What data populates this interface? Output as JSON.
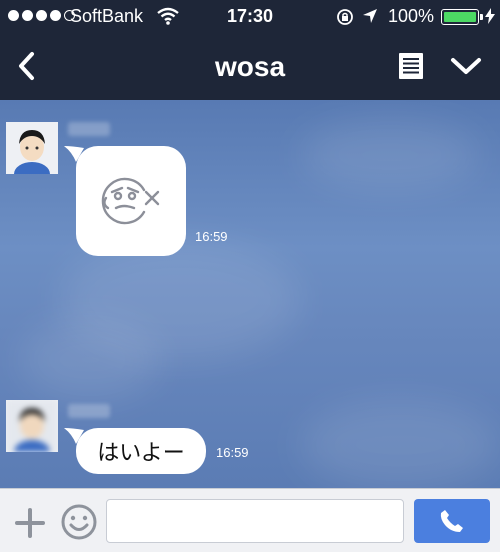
{
  "status_bar": {
    "carrier": "SoftBank",
    "time": "17:30",
    "battery_percent": "100%",
    "signal_dots_filled": 4,
    "signal_dots_total": 5,
    "battery_level": 1.0,
    "icons": [
      "wifi-icon",
      "rotation-lock-icon",
      "location-arrow-icon",
      "battery-icon",
      "charging-bolt-icon"
    ]
  },
  "nav_bar": {
    "title": "wosa",
    "icons": [
      "back-chevron-icon",
      "notes-icon",
      "chevron-down-icon"
    ]
  },
  "messages": [
    {
      "type": "sticker",
      "sticker": "face-sticker",
      "time": "16:59"
    },
    {
      "type": "text",
      "text": "はいよー",
      "time": "16:59"
    }
  ],
  "input_bar": {
    "message_value": "",
    "icons": [
      "plus-icon",
      "emoji-icon",
      "phone-icon"
    ]
  },
  "colors": {
    "nav_background": "#1e2638",
    "chat_background": "#6787bd",
    "call_button": "#4b7fdf",
    "battery_fill": "#4cd964"
  }
}
